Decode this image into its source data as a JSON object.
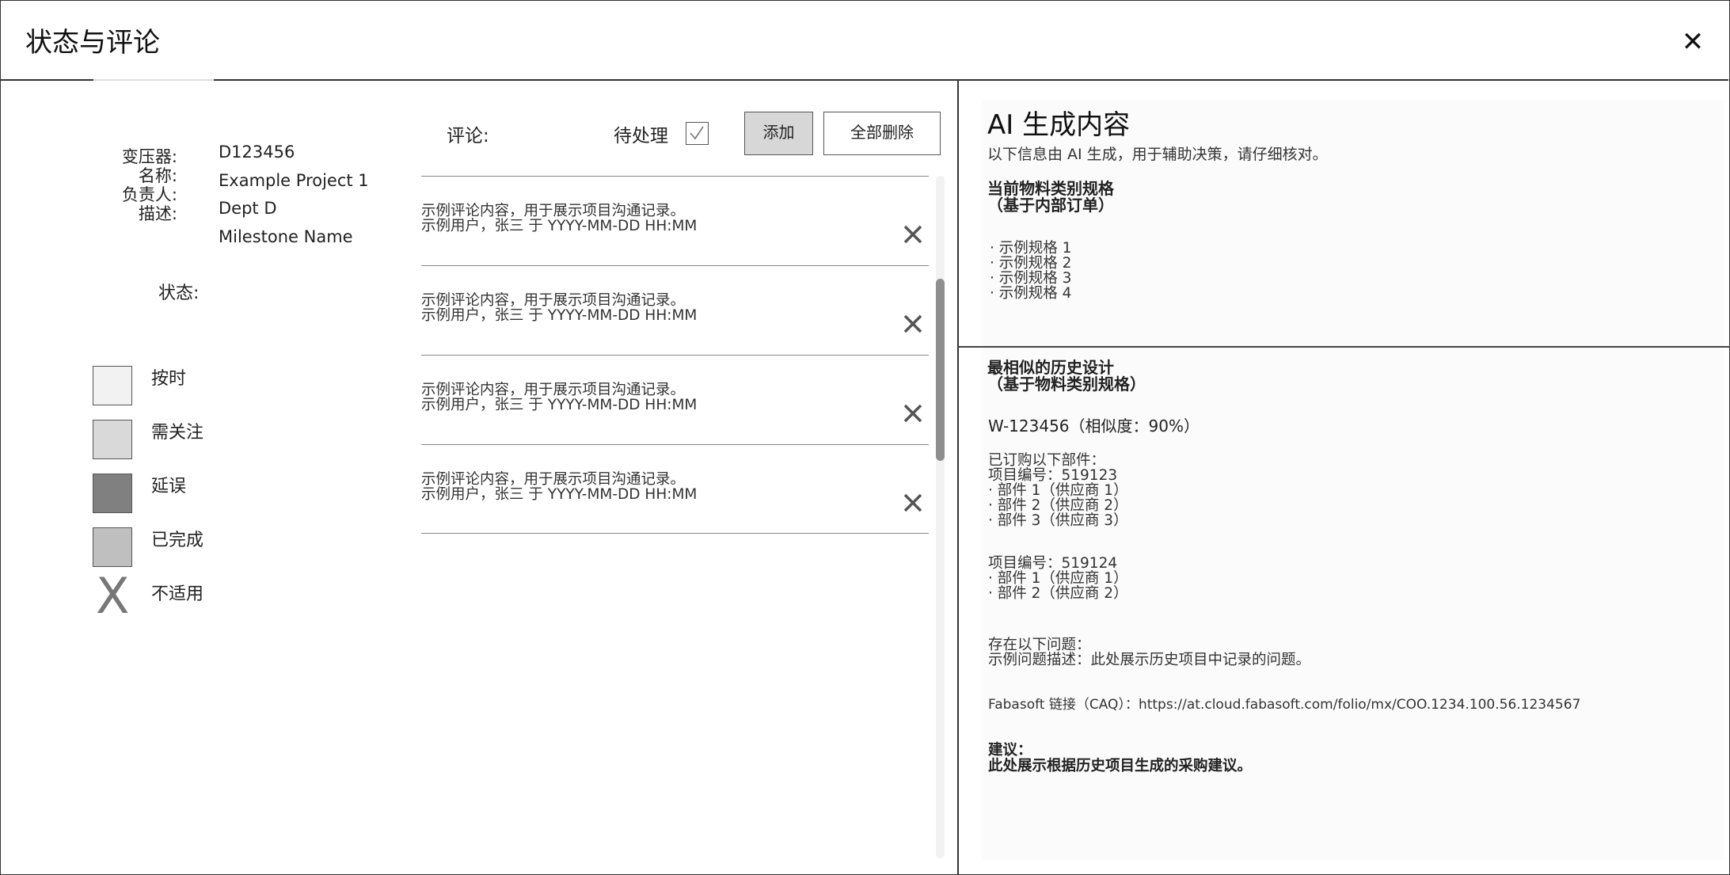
{
  "dialog": {
    "title": "状态与评论",
    "close_icon": "close-icon"
  },
  "info": {
    "labels": [
      "变压器:",
      "名称:",
      "负责人:",
      "描述:"
    ],
    "values": [
      "D123456",
      "Example Project 1",
      "Dept D",
      "Milestone Name"
    ]
  },
  "status": {
    "label": "状态:",
    "legend": [
      {
        "label": "按时",
        "color": "#f2f2f2"
      },
      {
        "label": "需关注",
        "color": "#d9d9d9"
      },
      {
        "label": "延误",
        "color": "#808080"
      },
      {
        "label": "已完成",
        "color": "#bfbfbf"
      },
      {
        "label": "不适用",
        "icon": "x-icon",
        "icon_glyph": "X"
      }
    ]
  },
  "comments": {
    "label": "评论:",
    "pending_label": "待处理",
    "pending_checked": true,
    "add_label": "添加",
    "delete_all_label": "全部删除",
    "items": [
      {
        "text": "示例评论内容，用于展示项目沟通记录。",
        "meta": "示例用户，张三 于 YYYY-MM-DD HH:MM"
      },
      {
        "text": "示例评论内容，用于展示项目沟通记录。",
        "meta": "示例用户，张三 于 YYYY-MM-DD HH:MM"
      },
      {
        "text": "示例评论内容，用于展示项目沟通记录。",
        "meta": "示例用户，张三 于 YYYY-MM-DD HH:MM"
      },
      {
        "text": "示例评论内容，用于展示项目沟通记录。",
        "meta": "示例用户，张三 于 YYYY-MM-DD HH:MM"
      }
    ]
  },
  "ai": {
    "heading": "AI 生成内容",
    "subtitle": "以下信息由 AI 生成，用于辅助决策，请仔细核对。",
    "spec_title_1": "当前物料类别规格",
    "spec_title_2": "（基于内部订单）",
    "specs": [
      "· 示例规格 1",
      "· 示例规格 2",
      "· 示例规格 3",
      "· 示例规格 4"
    ],
    "history_title_1": "最相似的历史设计",
    "history_title_2": "（基于物料类别规格）",
    "similar": "W-123456（相似度：90%）",
    "ordered_intro": "已订购以下部件：",
    "projects": [
      {
        "number": "项目编号：519123",
        "parts": [
          "· 部件 1（供应商 1）",
          "· 部件 2（供应商 2）",
          "· 部件 3（供应商 3）"
        ]
      },
      {
        "number": "项目编号：519124",
        "parts": [
          "· 部件 1（供应商 1）",
          "· 部件 2（供应商 2）"
        ]
      }
    ],
    "issues_intro": "存在以下问题：",
    "issues_text": "示例问题描述：此处展示历史项目中记录的问题。",
    "link_line": "Fabasoft 链接（CAQ）：https://at.cloud.fabasoft.com/folio/mx/COO.1234.100.56.1234567",
    "advice_title": "建议：",
    "advice_text": "此处展示根据历史项目生成的采购建议。"
  }
}
